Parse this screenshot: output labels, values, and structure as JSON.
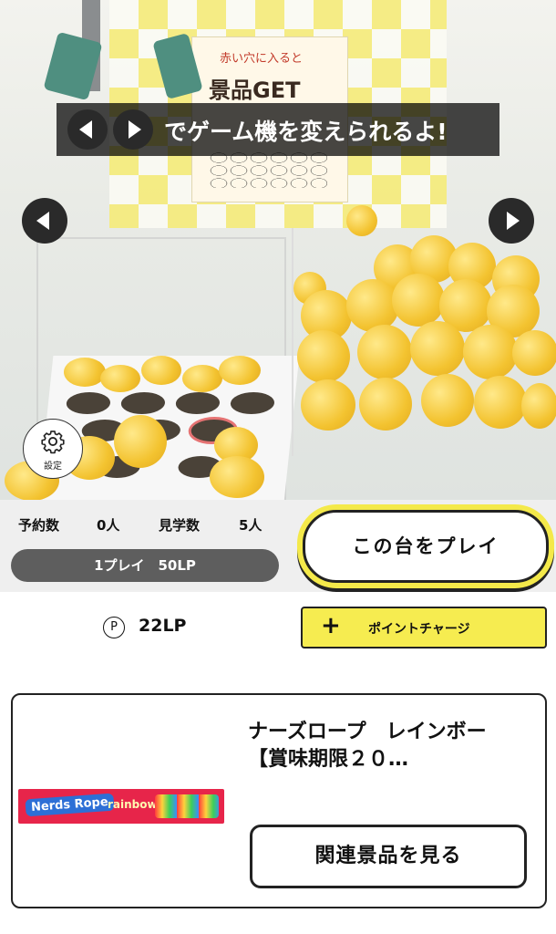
{
  "camera": {
    "poster_top_text": "赤い穴に入ると",
    "poster_main_text": "景品GET"
  },
  "banner": {
    "text": "でゲーム機を変えられるよ!"
  },
  "settings": {
    "label": "設定"
  },
  "info": {
    "reserve_label": "予約数",
    "reserve_value": "0人",
    "watch_label": "見学数",
    "watch_value": "5人",
    "price_text": "1プレイ　50LP",
    "play_button": "この台をプレイ"
  },
  "points": {
    "icon_glyph": "P",
    "value": "22LP",
    "charge_plus": "+",
    "charge_label": "ポイントチャージ"
  },
  "product": {
    "image_logo": "Nerds Rope",
    "image_brand": "rainbow",
    "title": "ナーズロープ　レインボー【賞味期限２０…",
    "related_button": "関連景品を見る"
  },
  "colors": {
    "accent_yellow": "#f6ec50",
    "price_bar": "#5e5e5e",
    "banner_bg": "#000000"
  }
}
